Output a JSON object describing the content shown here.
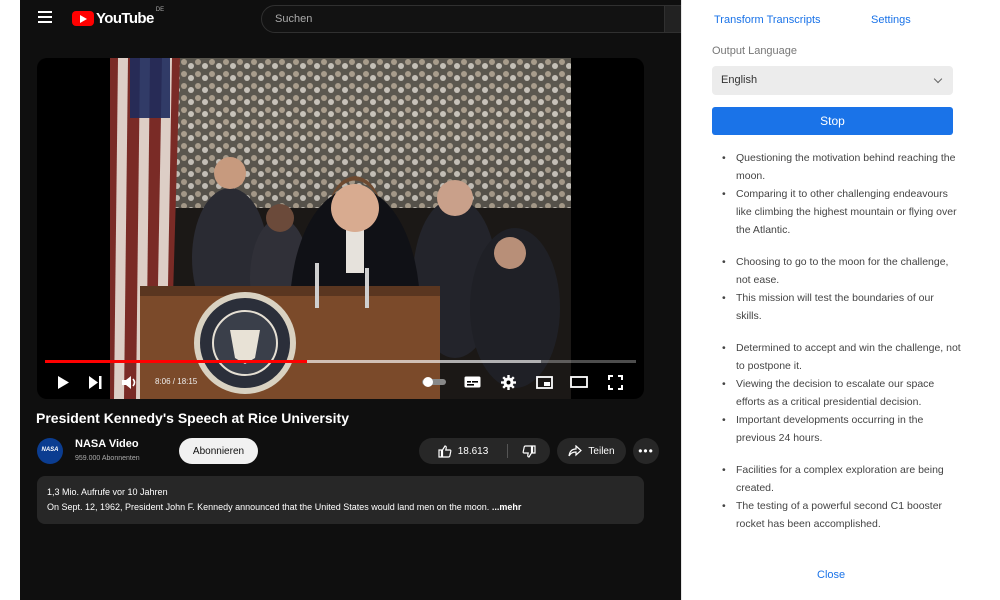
{
  "youtube": {
    "logo_text": "YouTube",
    "logo_country": "DE",
    "search_placeholder": "Suchen",
    "player": {
      "time": "8:06 / 18:15",
      "progress_fraction": 0.444,
      "buffer_fraction": 0.84
    },
    "video_title": "President Kennedy's Speech at Rice University",
    "channel": {
      "avatar_text": "NASA",
      "name": "NASA Video",
      "subscribers": "959.000 Abonnenten",
      "subscribe_label": "Abonnieren"
    },
    "actions": {
      "likes": "18.613",
      "share_label": "Teilen",
      "more_label": "•••"
    },
    "description": {
      "meta": "1,3 Mio. Aufrufe  vor 10 Jahren",
      "text": "On Sept. 12, 1962, President John F. Kennedy announced that the United States would land men on the moon. ",
      "more": "...mehr"
    }
  },
  "panel": {
    "tabs": {
      "transform": "Transform Transcripts",
      "settings": "Settings"
    },
    "language_label": "Output Language",
    "language_value": "English",
    "stop_label": "Stop",
    "summary_groups": [
      [
        "Questioning the motivation behind reaching the moon.",
        "Comparing it to other challenging endeavours like climbing the highest mountain or flying over the Atlantic."
      ],
      [
        "Choosing to go to the moon for the challenge, not ease.",
        "This mission will test the boundaries of our skills."
      ],
      [
        "Determined to accept and win the challenge, not to postpone it.",
        "Viewing the decision to escalate our space efforts as a critical presidential decision.",
        "Important developments occurring in the previous 24 hours."
      ],
      [
        "Facilities for a complex exploration are being created.",
        "The testing of a powerful second C1 booster rocket has been accomplished."
      ]
    ],
    "close_label": "Close"
  },
  "colors": {
    "accent_blue": "#1a73e8",
    "youtube_red": "#ff0000",
    "dark_bg": "#0f0f0f"
  }
}
